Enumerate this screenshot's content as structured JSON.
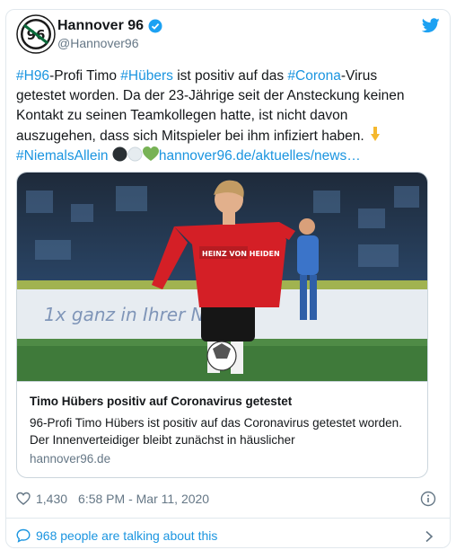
{
  "tweet": {
    "account_name": "Hannover 96",
    "handle": "@Hannover96",
    "text": {
      "tag_h96": "#H96",
      "t1": "-Profi Timo ",
      "tag_huebers": "#Hübers",
      "t2": " ist positiv auf das ",
      "tag_corona": "#Corona",
      "t3": "-Virus getestet worden. Da der 23-Jährige seit der Ansteckung keinen Kontakt zu seinen Teamkollegen hatte, ist nicht davon auszugehen, dass sich Mitspieler bei ihm infiziert haben. ",
      "tag_niemals": "#NiemalsAllein",
      "link": "hannover96.de/aktuelles/news…"
    },
    "preview": {
      "title": "Timo Hübers positiv auf Coronavirus getestet",
      "description": "96-Profi Timo Hübers ist positiv auf das Coronavirus getestet worden. Der Innenverteidiger bleibt zunächst in häuslicher",
      "domain": "hannover96.de",
      "banner_text": "1x ganz in Ihrer Nähe",
      "jersey_text": "HEINZ VON HEIDEN"
    },
    "likes": "1,430",
    "timestamp": "6:58 PM - Mar 11, 2020",
    "talking": "968 people are talking about this"
  },
  "colors": {
    "link": "#1b95e0",
    "secondary": "#657786",
    "border": "#e1e8ed",
    "club_green": "#0a6b3a"
  },
  "icons": [
    "club-crest-icon",
    "verified-icon",
    "twitter-bird-icon",
    "point-down-emoji",
    "black-circle-emoji",
    "white-circle-emoji",
    "green-heart-emoji",
    "heart-icon",
    "info-icon",
    "speech-bubble-icon",
    "chevron-right-icon"
  ]
}
